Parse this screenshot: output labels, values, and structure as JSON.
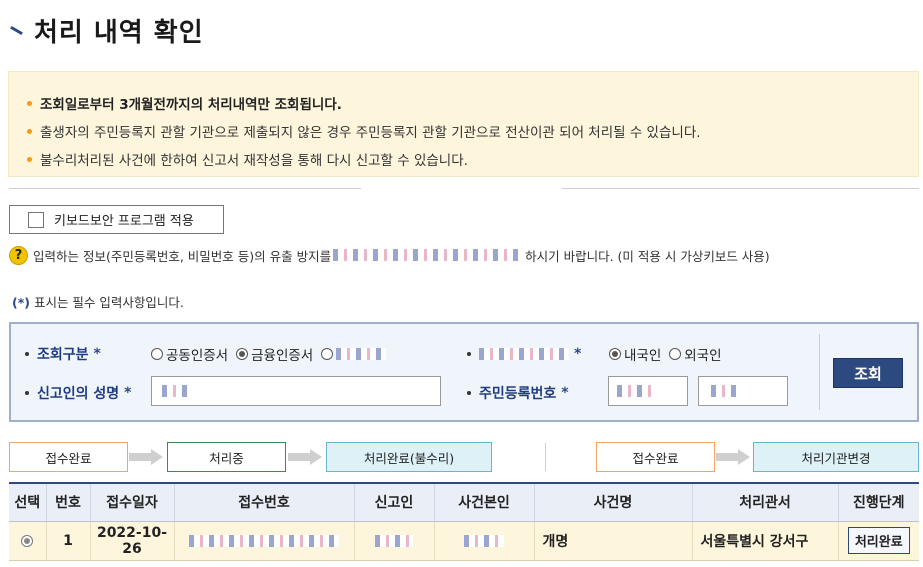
{
  "page": {
    "title": "처리 내역 확인"
  },
  "notice": {
    "lines": [
      "조회일로부터 3개월전까지의 처리내역만 조회됩니다.",
      "출생자의 주민등록지 관할 기관으로 제출되지 않은 경우 주민등록지 관할 기관으로 전산이관 되어 처리될 수 있습니다.",
      "불수리처리된 사건에 한하여 신고서 재작성을 통해 다시 신고할 수 있습니다."
    ]
  },
  "keyboard_security": {
    "button_label": "키보드보안 프로그램 적용",
    "info_prefix": "입력하는 정보(주민등록번호, 비밀번호 등)의 유출 방지를",
    "info_suffix": "하시기 바랍니다. (미 적용 시 가상키보드 사용)",
    "help_icon_glyph": "?"
  },
  "required_note": {
    "star": "(*)",
    "text": " 표시는 필수 입력사항입니다."
  },
  "search": {
    "inquiry_type_label": "조회구분",
    "inquiry_options": [
      {
        "label": "공동인증서",
        "selected": false
      },
      {
        "label": "금융인증서",
        "selected": true
      },
      {
        "label": "",
        "selected": false
      }
    ],
    "nationality_options": [
      {
        "label": "내국인",
        "selected": true
      },
      {
        "label": "외국인",
        "selected": false
      }
    ],
    "reporter_name_label": "신고인의 성명",
    "resident_number_label": "주민등록번호",
    "required_mark": "*",
    "search_button": "조회"
  },
  "steps": {
    "flow1": [
      "접수완료",
      "처리중",
      "처리완료(불수리)"
    ],
    "flow2": [
      "접수완료",
      "처리기관변경"
    ]
  },
  "table": {
    "headers": [
      "선택",
      "번호",
      "접수일자",
      "접수번호",
      "신고인",
      "사건본인",
      "사건명",
      "처리관서",
      "진행단계"
    ],
    "rows": [
      {
        "number": "1",
        "date": "2022-10-26",
        "case_name": "개명",
        "office": "서울특별시 강서구",
        "status": "처리완료"
      }
    ]
  },
  "colors": {
    "accent": "#2d4a80",
    "notice_bg": "#fdf6dd",
    "bullet": "#f39c12"
  }
}
